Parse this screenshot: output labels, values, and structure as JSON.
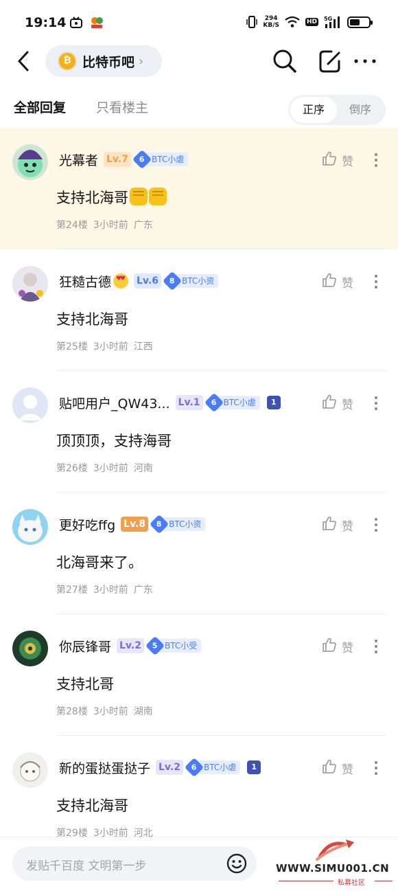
{
  "status_bar": {
    "time": "19:14",
    "net_speed_value": "294",
    "net_speed_unit": "KB/S",
    "hd_label": "HD",
    "battery_level": 0.55
  },
  "nav": {
    "forum_name": "比特币吧",
    "icons": [
      "back-icon",
      "search-icon",
      "edit-icon",
      "more-icon"
    ]
  },
  "filter": {
    "tab_all": "全部回复",
    "tab_op": "只看楼主",
    "order_asc": "正序",
    "order_desc": "倒序"
  },
  "like_label": "赞",
  "replies": [
    {
      "username": "光幕者",
      "level": "Lv.7",
      "level_color": "#f0a04b",
      "level_bg": "#fde4c4",
      "honor_num": "6",
      "honor_text": "BTC小虐",
      "honor_color": "#4a7cf6",
      "has_medal": false,
      "content": "支持北海哥",
      "fist_emojis": 2,
      "floor": "第24楼",
      "time": "3小时前",
      "location": "广东",
      "highlight": true
    },
    {
      "username": "狂糙古德",
      "level": "Lv.6",
      "level_color": "#4a7cf6",
      "level_bg": "#dfe8fd",
      "honor_num": "8",
      "honor_text": "BTC小资",
      "honor_color": "#4a7cf6",
      "has_medal": false,
      "has_face_emoji": true,
      "content": "支持北海哥",
      "fist_emojis": 0,
      "floor": "第25楼",
      "time": "3小时前",
      "location": "江西",
      "highlight": false
    },
    {
      "username": "贴吧用户_QW43...",
      "level": "Lv.1",
      "level_color": "#7b6cd9",
      "level_bg": "#e8e5fb",
      "honor_num": "6",
      "honor_text": "BTC小虐",
      "honor_color": "#4a7cf6",
      "has_medal": true,
      "medal_num": "1",
      "content": "顶顶顶，支持海哥",
      "fist_emojis": 0,
      "floor": "第26楼",
      "time": "3小时前",
      "location": "河南",
      "highlight": false
    },
    {
      "username": "更好吃ffg",
      "level": "Lv.8",
      "level_color": "#ffffff",
      "level_bg": "#f0a04b",
      "honor_num": "8",
      "honor_text": "BTC小资",
      "honor_color": "#4a7cf6",
      "has_medal": false,
      "content": "北海哥来了。",
      "fist_emojis": 0,
      "floor": "第27楼",
      "time": "3小时前",
      "location": "广东",
      "highlight": false
    },
    {
      "username": "你辰锋哥",
      "level": "Lv.2",
      "level_color": "#7b6cd9",
      "level_bg": "#e8e5fb",
      "honor_num": "5",
      "honor_text": "BTC小受",
      "honor_color": "#4a7cf6",
      "has_medal": false,
      "content": "支持北哥",
      "fist_emojis": 0,
      "floor": "第28楼",
      "time": "3小时前",
      "location": "湖南",
      "highlight": false
    },
    {
      "username": "新的蛋挞蛋挞子",
      "level": "Lv.2",
      "level_color": "#7b6cd9",
      "level_bg": "#e8e5fb",
      "honor_num": "6",
      "honor_text": "BTC小虐",
      "honor_color": "#4a7cf6",
      "has_medal": true,
      "medal_num": "1",
      "content": "支持北海哥",
      "fist_emojis": 0,
      "floor": "第29楼",
      "time": "3小时前",
      "location": "河北",
      "highlight": false
    }
  ],
  "bottom": {
    "input_placeholder": "发贴千百度 文明第一步",
    "watermark_text": "WWW.SIMU001.CN",
    "watermark_sub": "私募社区"
  }
}
